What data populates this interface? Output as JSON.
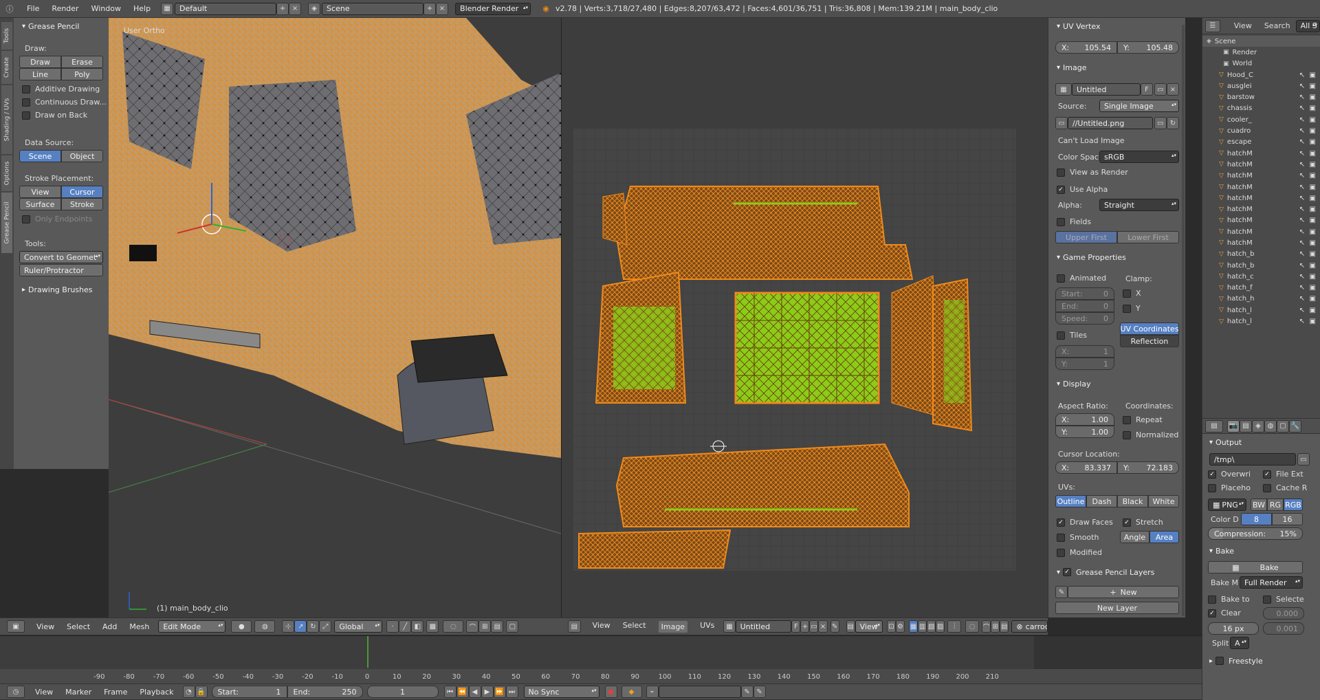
{
  "topbar": {
    "menus": [
      "File",
      "Render",
      "Window",
      "Help"
    ],
    "layout": "Default",
    "scene": "Scene",
    "engine": "Blender Render",
    "stats": "v2.78 | Verts:3,718/27,480 | Edges:8,207/63,472 | Faces:4,601/36,751 | Tris:36,808 | Mem:139.21M | main_body_clio"
  },
  "tool_tabs": [
    "Tools",
    "Create",
    "Shading / UVs",
    "Options",
    "Grease Pencil"
  ],
  "grease_panel": {
    "title": "Grease Pencil",
    "draw_label": "Draw:",
    "draw": "Draw",
    "erase": "Erase",
    "line": "Line",
    "poly": "Poly",
    "additive": "Additive Drawing",
    "continuous": "Continuous Draw...",
    "draw_on_back": "Draw on Back",
    "data_source": "Data Source:",
    "scene": "Scene",
    "object": "Object",
    "stroke_placement": "Stroke Placement:",
    "view": "View",
    "cursor": "Cursor",
    "surface": "Surface",
    "stroke": "Stroke",
    "only_endpoints": "Only Endpoints",
    "tools": "Tools:",
    "convert": "Convert to Geomet",
    "ruler": "Ruler/Protractor",
    "brushes": "Drawing Brushes"
  },
  "viewport": {
    "label": "User Ortho",
    "object": "(1) main_body_clio"
  },
  "view3d_header": {
    "menus": [
      "View",
      "Select",
      "Add",
      "Mesh"
    ],
    "mode": "Edit Mode",
    "orientation": "Global"
  },
  "uv_header": {
    "menus": [
      "View",
      "Select",
      "Image",
      "UVs"
    ],
    "image": "Untitled",
    "f": "F",
    "view": "View",
    "obj": "carroceria"
  },
  "uv_panel": {
    "uv_vertex": {
      "title": "UV Vertex",
      "x": "X:",
      "x_val": "105.54",
      "y": "Y:",
      "y_val": "105.48"
    },
    "image": {
      "title": "Image",
      "name": "Untitled",
      "f": "F",
      "source_label": "Source:",
      "source": "Single Image",
      "path": "//Untitled.png",
      "cant_load": "Can't Load Image",
      "color_space_label": "Color Spac",
      "color_space": "sRGB",
      "view_as_render": "View as Render",
      "use_alpha": "Use Alpha",
      "alpha_label": "Alpha:",
      "alpha": "Straight",
      "fields": "Fields",
      "upper_first": "Upper First",
      "lower_first": "Lower First"
    },
    "game": {
      "title": "Game Properties",
      "animated": "Animated",
      "clamp": "Clamp:",
      "start": "Start:",
      "start_val": "0",
      "end": "End:",
      "end_val": "0",
      "speed": "Speed:",
      "speed_val": "0",
      "cx": "X",
      "cy": "Y",
      "tiles": "Tiles",
      "tx": "X:",
      "tx_val": "1",
      "ty": "Y:",
      "ty_val": "1",
      "uv_coords": "UV Coordinates",
      "reflection": "Reflection"
    },
    "display": {
      "title": "Display",
      "aspect": "Aspect Ratio:",
      "coords": "Coordinates:",
      "ax": "X:",
      "ax_val": "1.00",
      "ay": "Y:",
      "ay_val": "1.00",
      "repeat": "Repeat",
      "normalized": "Normalized",
      "cursor_loc": "Cursor Location:",
      "cx": "X:",
      "cx_val": "83.337",
      "cy": "Y:",
      "cy_val": "72.183",
      "uvs": "UVs:",
      "outline": "Outline",
      "dash": "Dash",
      "black": "Black",
      "white": "White",
      "draw_faces": "Draw Faces",
      "stretch": "Stretch",
      "smooth": "Smooth",
      "angle": "Angle",
      "area": "Area",
      "modified": "Modified"
    },
    "gp_layers": {
      "title": "Grease Pencil Layers",
      "new": "New",
      "new_layer": "New Layer"
    }
  },
  "outliner": {
    "view": "View",
    "search": "Search",
    "all": "All S",
    "items": [
      "Scene",
      "Render",
      "World",
      "Hood_C",
      "ausglei",
      "barstow",
      "chassis",
      "cooler_",
      "cuadro",
      "escape",
      "hatchM",
      "hatchM",
      "hatchM",
      "hatchM",
      "hatchM",
      "hatchM",
      "hatchM",
      "hatchM",
      "hatchM",
      "hatch_b",
      "hatch_b",
      "hatch_c",
      "hatch_f",
      "hatch_h",
      "hatch_l",
      "hatch_l"
    ]
  },
  "props": {
    "output": "Output",
    "path": "/tmp\\",
    "overwrite": "Overwri",
    "file_ext": "File Ext",
    "placeholders": "Placeho",
    "cache": "Cache R",
    "format": "PNG",
    "bw": "BW",
    "rgb": "RG",
    "rgba": "RGB",
    "color_depth": "Color D",
    "d8": "8",
    "d16": "16",
    "compression": "Compression:",
    "compression_val": "15%",
    "bake": "Bake",
    "bake_btn": "Bake",
    "bake_mode_label": "Bake M",
    "bake_mode": "Full Render",
    "bake_to": "Bake to",
    "selected": "Selecte",
    "clear": "Clear",
    "clear_val": "0.000",
    "margin": "16 px",
    "margin_val": "0.001",
    "split": "Split",
    "split_val": "A",
    "freestyle": "Freestyle"
  },
  "timeline": {
    "ticks": [
      "-90",
      "-80",
      "-70",
      "-60",
      "-50",
      "-40",
      "-30",
      "-20",
      "-10",
      "0",
      "10",
      "20",
      "30",
      "40",
      "50",
      "60",
      "70",
      "80",
      "90",
      "100",
      "110",
      "120",
      "130",
      "140",
      "150",
      "160",
      "170",
      "180",
      "190",
      "200",
      "210"
    ],
    "menus": [
      "View",
      "Marker",
      "Frame",
      "Playback"
    ],
    "start": "Start:",
    "start_val": "1",
    "end": "End:",
    "end_val": "250",
    "current": "1",
    "sync": "No Sync"
  },
  "colors": {
    "orange": "#f08a1a",
    "uv_green": "#8ccc18",
    "selected_blue": "#5680c2"
  }
}
